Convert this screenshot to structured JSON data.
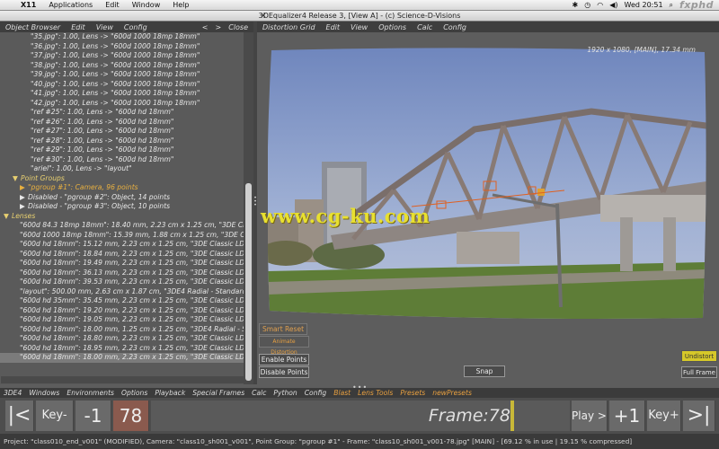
{
  "macbar": {
    "app": "X11",
    "menus": [
      "Applications",
      "Edit",
      "Window",
      "Help"
    ],
    "clock": "Wed 20:51",
    "watermark": "fxphd"
  },
  "window": {
    "title": "3DEqualizer4 Release 3, [View A]  -  (c) Science-D-Visions"
  },
  "left": {
    "header": {
      "title": "Object Browser",
      "menus": [
        "Edit",
        "View",
        "Config"
      ],
      "close": "Close"
    },
    "point_rows": [
      "\"35.jpg\": 1.00, Lens -> \"600d 1000 18mp 18mm\"",
      "\"36.jpg\": 1.00, Lens -> \"600d 1000 18mp 18mm\"",
      "\"37.jpg\": 1.00, Lens -> \"600d 1000 18mp 18mm\"",
      "\"38.jpg\": 1.00, Lens -> \"600d 1000 18mp 18mm\"",
      "\"39.jpg\": 1.00, Lens -> \"600d 1000 18mp 18mm\"",
      "\"40.jpg\": 1.00, Lens -> \"600d 1000 18mp 18mm\"",
      "\"41.jpg\": 1.00, Lens -> \"600d 1000 18mp 18mm\"",
      "\"42.jpg\": 1.00, Lens -> \"600d 1000 18mp 18mm\"",
      "\"ref #25\": 1.00, Lens -> \"600d hd 18mm\"",
      "\"ref #26\": 1.00, Lens -> \"600d hd 18mm\"",
      "\"ref #27\": 1.00, Lens -> \"600d hd 18mm\"",
      "\"ref #28\": 1.00, Lens -> \"600d hd 18mm\"",
      "\"ref #29\": 1.00, Lens -> \"600d hd 18mm\"",
      "\"ref #30\": 1.00, Lens -> \"600d hd 18mm\"",
      "\"ariel\": 1.00, Lens -> \"layout\""
    ],
    "point_groups_label": "Point Groups",
    "groups": [
      "\"pgroup #1\": Camera, 96 points",
      "Disabled - \"pgroup #2\": Object, 14 points",
      "Disabled - \"pgroup #3\": Object, 10 points"
    ],
    "lenses_label": "Lenses",
    "lenses": [
      "\"600d 84.3 18mp 18mm\": 18.40 mm, 2.23 cm x 1.25 cm, \"3DE Classi",
      "\"600d 1000 18mp 18mm\": 15.39 mm, 1.88 cm x 1.25 cm, \"3DE Class",
      "\"600d hd 18mm\": 15.12 mm, 2.23 cm x 1.25 cm, \"3DE Classic LD Mo",
      "\"600d hd 18mm\": 18.84 mm, 2.23 cm x 1.25 cm, \"3DE Classic LD Mo",
      "\"600d hd 18mm\": 19.49 mm, 2.23 cm x 1.25 cm, \"3DE Classic LD Mo",
      "\"600d hd 18mm\": 36.13 mm, 2.23 cm x 1.25 cm, \"3DE Classic LD Mo",
      "\"600d hd 18mm\": 39.53 mm, 2.23 cm x 1.25 cm, \"3DE Classic LD Mo",
      "\"layout\": 500.00 mm, 2.63 cm x 1.87 cm, \"3DE4 Radial - Standard, D",
      "\"600d hd 35mm\": 35.45 mm, 2.23 cm x 1.25 cm, \"3DE Classic LD Mo",
      "\"600d hd 18mm\": 19.20 mm, 2.23 cm x 1.25 cm, \"3DE Classic LD Mo",
      "\"600d hd 18mm\": 19.05 mm, 2.23 cm x 1.25 cm, \"3DE Classic LD Mo",
      "\"600d hd 18mm\": 18.00 mm, 1.25 cm x 1.25 cm, \"3DE4 Radial - Star",
      "\"600d hd 18mm\": 18.80 mm, 2.23 cm x 1.25 cm, \"3DE Classic LD Mo",
      "\"600d hd 18mm\": 18.95 mm, 2.23 cm x 1.25 cm, \"3DE Classic LD Mo",
      "\"600d hd 18mm\": 18.00 mm, 2.23 cm x 1.25 cm, \"3DE Classic LD Mo"
    ]
  },
  "right": {
    "header": {
      "title": "Distortion Grid",
      "menus": [
        "Edit",
        "View",
        "Options",
        "Calc",
        "Config"
      ]
    },
    "image_info": "1920 x 1080, [MAIN], 17.34 mm",
    "buttons": {
      "smart_reset": "Smart Reset",
      "animate_distortion": "Animate Distortion",
      "enable_points": "Enable Points",
      "disable_points": "Disable Points",
      "snap": "Snap",
      "undistort": "Undistort",
      "full_frame": "Full Frame"
    }
  },
  "overlay_watermark": "www.cg-ku.com",
  "bottom_menu": {
    "items": [
      "3DE4",
      "Windows",
      "Environments",
      "Options",
      "Playback",
      "Special Frames",
      "Calc",
      "Python",
      "Config"
    ],
    "orange_items": [
      "Blast",
      "Lens Tools",
      "Presets",
      "newPresets"
    ]
  },
  "timeline": {
    "first": "|<",
    "key_back": "Key-",
    "minus1": "-1",
    "frame": "78",
    "frame_label": "Frame:78",
    "play": "Play >",
    "plus1": "+1",
    "key_fwd": "Key+",
    "last": ">|"
  },
  "status": "Project: \"class010_end_v001\" (MODIFIED), Camera: \"class10_sh001_v001\", Point Group: \"pgroup #1\"  -  Frame: \"class10_sh001_v001-78.jpg\" [MAIN]  -  [69.12 % in use | 19.15 % compressed]"
}
